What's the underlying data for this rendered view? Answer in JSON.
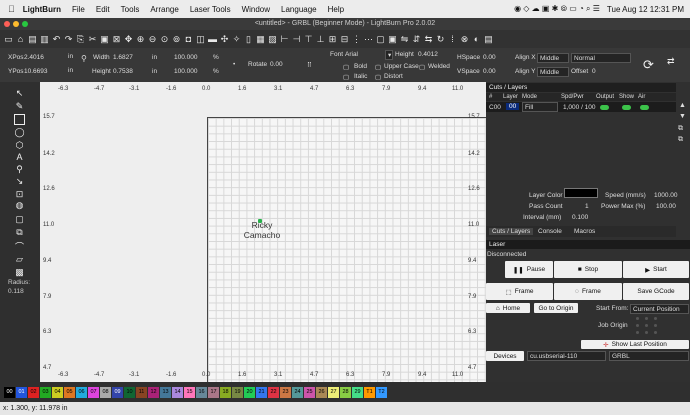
{
  "menubar": {
    "app": "LightBurn",
    "items": [
      "File",
      "Edit",
      "Tools",
      "Arrange",
      "Laser Tools",
      "Window",
      "Language",
      "Help"
    ],
    "clock": "Tue Aug 12  12:31 PM"
  },
  "window_title": "<untitled> - GRBL (Beginner Mode) - LightBurn Pro 2.0.02",
  "props": {
    "xpos_label": "XPos",
    "xpos": "2.4016",
    "ypos_label": "YPos",
    "ypos": "10.6693",
    "width_label": "Width",
    "width": "1.6827",
    "height_label": "Height",
    "height": "0.7538",
    "unit": "in",
    "scale_w": "100.000",
    "scale_h": "100.000",
    "pct": "%",
    "rotate_label": "Rotate",
    "rotate": "0.00",
    "font_label": "Font",
    "font": "Arial",
    "fheight_label": "Height",
    "fheight": "0.4012",
    "bold": "Bold",
    "italic": "Italic",
    "upper": "Upper Case",
    "welded": "Welded",
    "distort": "Distort",
    "hspace_label": "HSpace",
    "hspace": "0.00",
    "vspace_label": "VSpace",
    "vspace": "0.00",
    "alignx_label": "Align X",
    "alignx": "Middle",
    "aligny_label": "Align Y",
    "aligny": "Middle",
    "normal": "Normal",
    "offset_label": "Offset",
    "offset": "0"
  },
  "rulers": {
    "top": [
      "-6.3",
      "-4.7",
      "-3.1",
      "-1.6",
      "0.0",
      "1.6",
      "3.1",
      "4.7",
      "6.3",
      "7.9",
      "9.4",
      "11.0"
    ],
    "left": [
      "15.7",
      "14.2",
      "12.6",
      "11.0",
      "9.4",
      "7.9",
      "6.3",
      "4.7"
    ],
    "radius_label": "Radius:",
    "radius": "0.118"
  },
  "canvas_text": {
    "line1": "Ricky",
    "line2": "Camacho"
  },
  "cuts": {
    "title": "Cuts / Layers",
    "headers": [
      "#",
      "Layer",
      "Mode",
      "Spd/Pwr",
      "Output",
      "Show",
      "Air"
    ],
    "row": {
      "num": "C00",
      "layer": "00",
      "mode": "Fill",
      "spd": "1,000 / 100"
    },
    "layer_color_label": "Layer Color",
    "speed_label": "Speed (mm/s)",
    "speed": "1000.00",
    "pass_label": "Pass Count",
    "pass": "1",
    "power_label": "Power Max (%)",
    "power": "100.00",
    "interval_label": "Interval (mm)",
    "interval": "0.100"
  },
  "tabs": [
    "Cuts / Layers",
    "Console",
    "Macros"
  ],
  "laser": {
    "title": "Laser",
    "status": "Disconnected",
    "pause": "Pause",
    "stop": "Stop",
    "start": "Start",
    "frame1": "Frame",
    "frame2": "Frame",
    "save": "Save GCode",
    "home": "Home",
    "goto": "Go to Origin",
    "start_from_label": "Start From:",
    "start_from": "Current Position",
    "job_origin": "Job Origin",
    "show_last": "Show Last Position",
    "devices": "Devices",
    "port": "cu.usbserial-110",
    "device": "GRBL"
  },
  "palette": [
    "00",
    "01",
    "02",
    "03",
    "04",
    "05",
    "06",
    "07",
    "08",
    "09",
    "10",
    "11",
    "12",
    "13",
    "14",
    "15",
    "16",
    "17",
    "18",
    "19",
    "20",
    "21",
    "22",
    "23",
    "24",
    "25",
    "26",
    "27",
    "28",
    "29",
    "T1",
    "T2"
  ],
  "palette_colors": [
    "#000000",
    "#2255dd",
    "#dd2222",
    "#22aa22",
    "#cccc22",
    "#dd7722",
    "#22aadd",
    "#dd44dd",
    "#aaaaaa",
    "#3344aa",
    "#116633",
    "#884422",
    "#aa2277",
    "#447799",
    "#aa88dd",
    "#ff77bb",
    "#668899",
    "#aa7788",
    "#88aa22",
    "#778844",
    "#22cc55",
    "#3377ee",
    "#dd3344",
    "#cc7744",
    "#559999",
    "#cc55aa",
    "#aa8855",
    "#eeee77",
    "#88cc44",
    "#44dd88",
    "#ff9900",
    "#3399ff"
  ],
  "status": "x: 1.300, y: 11.978 in"
}
